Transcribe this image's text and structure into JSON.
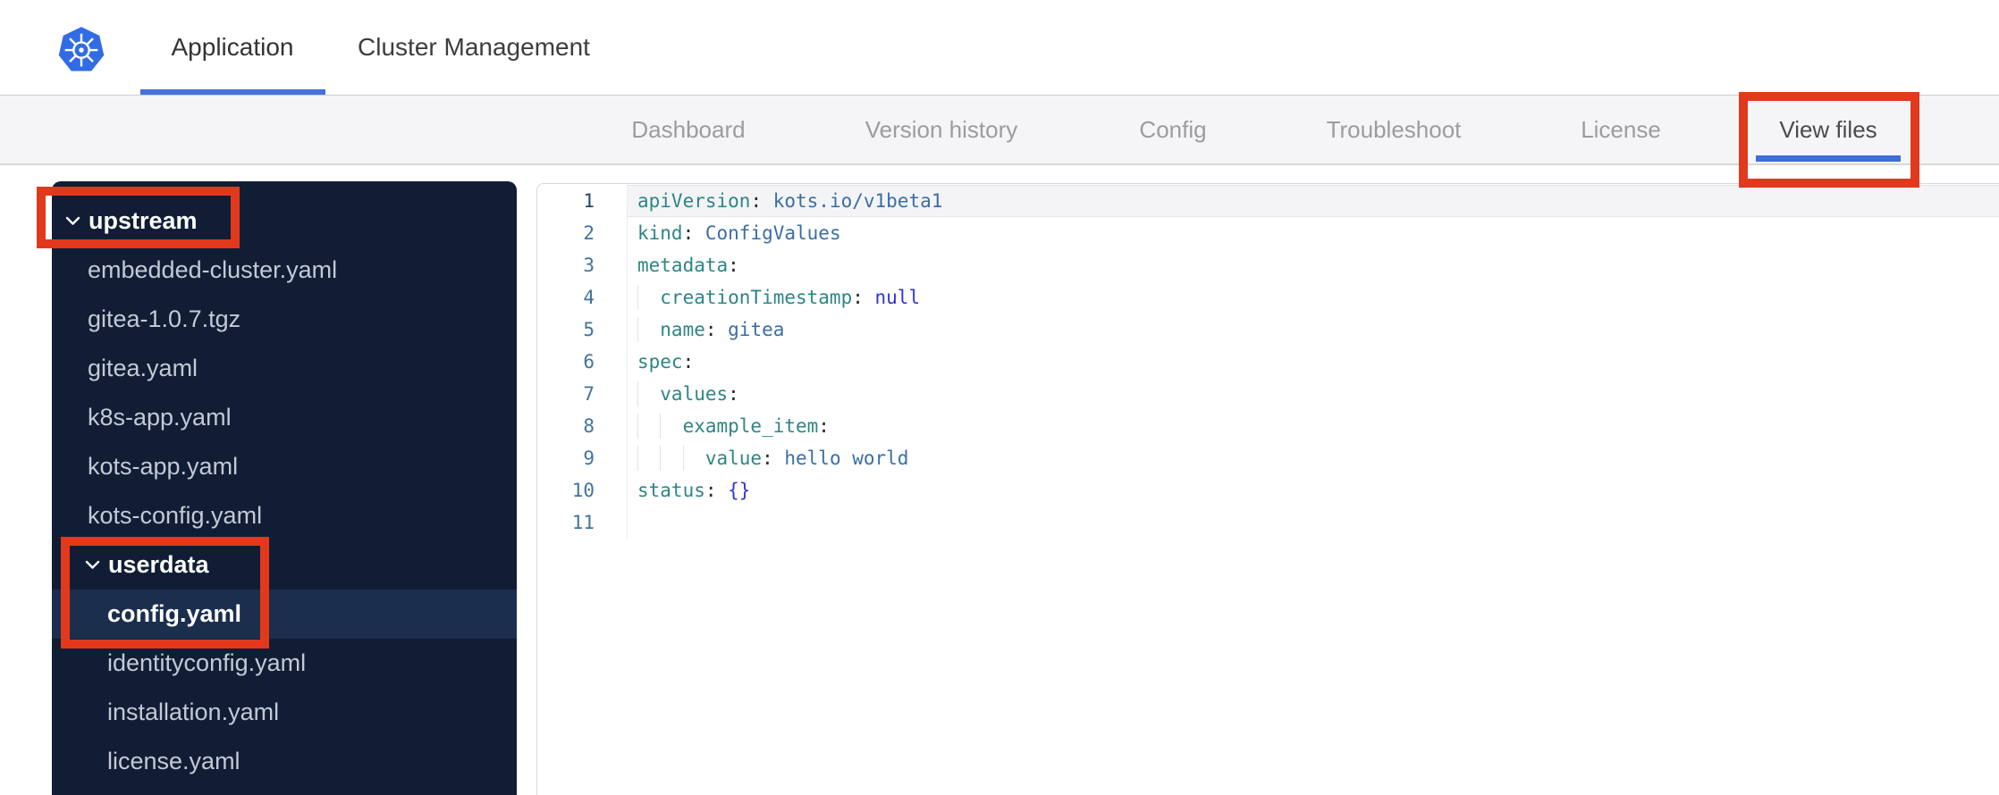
{
  "header": {
    "logo": "kubernetes-logo",
    "tabs": [
      {
        "label": "Application",
        "active": true
      },
      {
        "label": "Cluster Management",
        "active": false
      }
    ]
  },
  "subnav": {
    "items": [
      {
        "label": "Dashboard",
        "active": false
      },
      {
        "label": "Version history",
        "active": false
      },
      {
        "label": "Config",
        "active": false
      },
      {
        "label": "Troubleshoot",
        "active": false
      },
      {
        "label": "License",
        "active": false
      },
      {
        "label": "View files",
        "active": true
      }
    ]
  },
  "file_tree": {
    "rows": [
      {
        "kind": "folder",
        "label": "upstream",
        "depth": 0,
        "expanded": true
      },
      {
        "kind": "file",
        "label": "embedded-cluster.yaml",
        "depth": 1
      },
      {
        "kind": "file",
        "label": "gitea-1.0.7.tgz",
        "depth": 1
      },
      {
        "kind": "file",
        "label": "gitea.yaml",
        "depth": 1
      },
      {
        "kind": "file",
        "label": "k8s-app.yaml",
        "depth": 1
      },
      {
        "kind": "file",
        "label": "kots-app.yaml",
        "depth": 1
      },
      {
        "kind": "file",
        "label": "kots-config.yaml",
        "depth": 1
      },
      {
        "kind": "folder",
        "label": "userdata",
        "depth": 1,
        "expanded": true
      },
      {
        "kind": "file",
        "label": "config.yaml",
        "depth": 2,
        "selected": true
      },
      {
        "kind": "file",
        "label": "identityconfig.yaml",
        "depth": 2
      },
      {
        "kind": "file",
        "label": "installation.yaml",
        "depth": 2
      },
      {
        "kind": "file",
        "label": "license.yaml",
        "depth": 2
      }
    ]
  },
  "editor": {
    "language": "yaml",
    "raw_text": "apiVersion: kots.io/v1beta1\nkind: ConfigValues\nmetadata:\n  creationTimestamp: null\n  name: gitea\nspec:\n  values:\n    example_item:\n      value: hello world\nstatus: {}\n",
    "lines": [
      {
        "n": 1,
        "active": true,
        "guides": [],
        "tokens": [
          {
            "c": "key",
            "t": "apiVersion"
          },
          {
            "c": "punc",
            "t": ":"
          },
          {
            "c": "str",
            "t": " kots.io/v1beta1"
          }
        ]
      },
      {
        "n": 2,
        "guides": [],
        "tokens": [
          {
            "c": "key",
            "t": "kind"
          },
          {
            "c": "punc",
            "t": ":"
          },
          {
            "c": "str",
            "t": " ConfigValues"
          }
        ]
      },
      {
        "n": 3,
        "guides": [],
        "tokens": [
          {
            "c": "key",
            "t": "metadata"
          },
          {
            "c": "punc",
            "t": ":"
          }
        ]
      },
      {
        "n": 4,
        "guides": [
          0
        ],
        "tokens": [
          {
            "c": "key",
            "t": "  creationTimestamp"
          },
          {
            "c": "punc",
            "t": ":"
          },
          {
            "c": "const",
            "t": " null"
          }
        ]
      },
      {
        "n": 5,
        "guides": [
          0
        ],
        "tokens": [
          {
            "c": "key",
            "t": "  name"
          },
          {
            "c": "punc",
            "t": ":"
          },
          {
            "c": "str",
            "t": " gitea"
          }
        ]
      },
      {
        "n": 6,
        "guides": [],
        "tokens": [
          {
            "c": "key",
            "t": "spec"
          },
          {
            "c": "punc",
            "t": ":"
          }
        ]
      },
      {
        "n": 7,
        "guides": [
          0
        ],
        "tokens": [
          {
            "c": "key",
            "t": "  values"
          },
          {
            "c": "punc",
            "t": ":"
          }
        ]
      },
      {
        "n": 8,
        "guides": [
          0,
          2
        ],
        "tokens": [
          {
            "c": "key",
            "t": "    example_item"
          },
          {
            "c": "punc",
            "t": ":"
          }
        ]
      },
      {
        "n": 9,
        "guides": [
          0,
          2,
          4
        ],
        "tokens": [
          {
            "c": "key",
            "t": "      value"
          },
          {
            "c": "punc",
            "t": ":"
          },
          {
            "c": "str",
            "t": " hello world"
          }
        ]
      },
      {
        "n": 10,
        "guides": [],
        "tokens": [
          {
            "c": "key",
            "t": "status"
          },
          {
            "c": "punc",
            "t": ":"
          },
          {
            "c": "const",
            "t": " {}"
          }
        ]
      },
      {
        "n": 11,
        "guides": [],
        "tokens": []
      }
    ]
  },
  "annotations": {
    "color": "#e2391d",
    "boxes": [
      "upstream-folder",
      "userdata-config-yaml",
      "view-files-tab"
    ]
  },
  "colors": {
    "accent_underline": "#4372d9",
    "subnav_underline": "#3e6ed8",
    "sidebar_bg": "#101d35",
    "sidebar_selected_bg": "#1b2e4e",
    "code_key": "#2e8585",
    "code_string": "#3a6ea5",
    "code_constant": "#3232dc",
    "line_number": "#41749b",
    "kubernetes_blue": "#326ce5"
  }
}
